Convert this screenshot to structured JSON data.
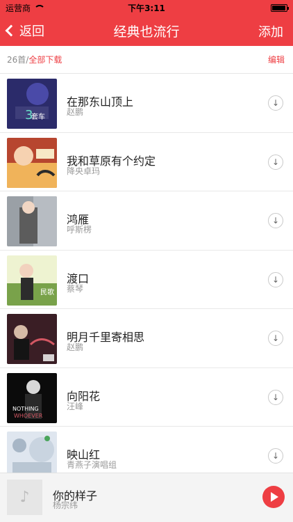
{
  "status": {
    "carrier": "运营商",
    "time": "下午3:11"
  },
  "nav": {
    "back": "返回",
    "title": "经典也流行",
    "add": "添加"
  },
  "subhead": {
    "count": "26首/",
    "download_all": "全部下载",
    "edit": "编辑"
  },
  "songs": [
    {
      "title": "在那东山顶上",
      "artist": "赵鹏",
      "cover_color": "#2b2b6a",
      "accent": "#f2b8c6"
    },
    {
      "title": "我和草原有个约定",
      "artist": "降央卓玛",
      "cover_color": "#b7462f",
      "accent": "#f0b35a"
    },
    {
      "title": "鸿雁",
      "artist": "呼斯楞",
      "cover_color": "#9aa0a6",
      "accent": "#5c5c5c"
    },
    {
      "title": "渡口",
      "artist": "蔡琴",
      "cover_color": "#79a24a",
      "accent": "#eef3d1"
    },
    {
      "title": "明月千里寄相思",
      "artist": "赵鹏",
      "cover_color": "#3a1e25",
      "accent": "#d35763"
    },
    {
      "title": "向阳花",
      "artist": "汪峰",
      "cover_color": "#0b0b0b",
      "accent": "#d8d8d8"
    },
    {
      "title": "映山红",
      "artist": "青燕子演唱组",
      "cover_color": "#dfe6ef",
      "accent": "#a7b6c6"
    }
  ],
  "player": {
    "title": "你的样子",
    "artist": "杨宗纬"
  }
}
